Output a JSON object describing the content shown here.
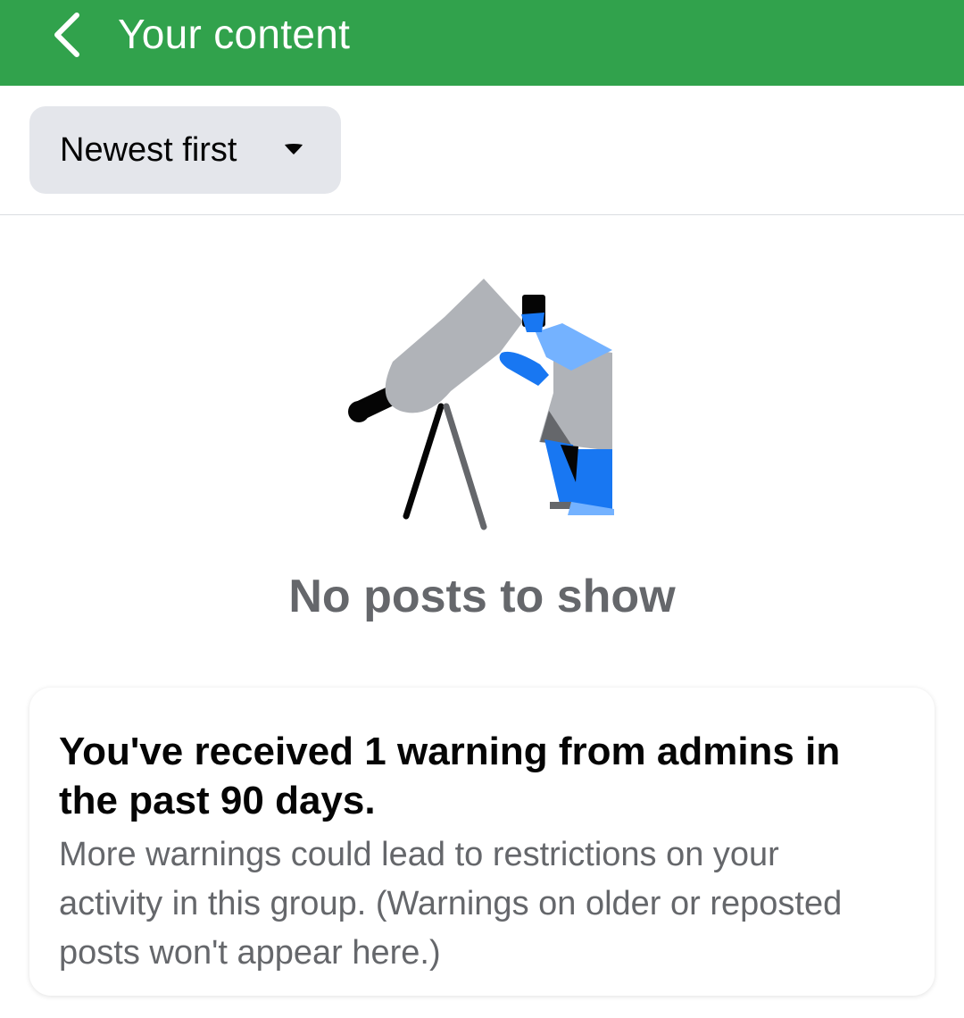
{
  "header": {
    "title": "Your content",
    "back_icon": "chevron-left-icon",
    "background": "#31a24c"
  },
  "sort": {
    "label": "Newest first",
    "icon": "caret-down-icon"
  },
  "empty_state": {
    "illustration": "telescope-person-illustration",
    "message": "No posts to show"
  },
  "warning_card": {
    "title": "You've received 1 warning from admins in the past 90 days.",
    "body": "More warnings could lead to restrictions on your activity in this group. (Warnings on older or reposted posts won't appear here.)"
  },
  "colors": {
    "accent_blue": "#1877f2",
    "light_blue": "#74b2ff",
    "gray": "#b0b3b8",
    "text_secondary": "#65676b"
  }
}
